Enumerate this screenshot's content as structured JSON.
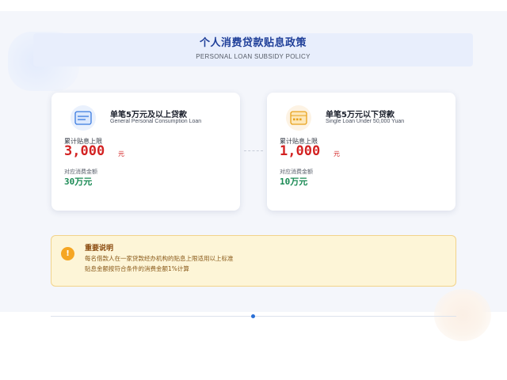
{
  "header": {
    "title": "个人消费贷款贴息政策",
    "subtitle": "PERSONAL LOAN SUBSIDY POLICY"
  },
  "cards": [
    {
      "icon": "credit-card-icon",
      "title": "单笔5万元及以上贷款",
      "subtitle": "General Personal Consumption Loan",
      "limit_label": "累计贴息上限",
      "limit_value": "3,000",
      "limit_unit": "元",
      "amount_label": "对应消费金额",
      "amount_value": "30万元"
    },
    {
      "icon": "card-chip-icon",
      "title": "单笔5万元以下贷款",
      "subtitle": "Single Loan Under 50,000 Yuan",
      "limit_label": "累计贴息上限",
      "limit_value": "1,000",
      "limit_unit": "元",
      "amount_label": "对应消费金额",
      "amount_value": "10万元"
    }
  ],
  "notice": {
    "icon": "exclamation-icon",
    "icon_glyph": "!",
    "title": "重要说明",
    "lines": [
      "每名借款人在一家贷款经办机构的贴息上限适用以上标准",
      "贴息金额按符合条件的消费金额1%计算"
    ]
  },
  "colors": {
    "accent_blue": "#1f3f99",
    "limit_red": "#d32222",
    "amount_green": "#1a8a54",
    "notice_bg": "#fdf5d7",
    "notice_icon": "#f5a623"
  }
}
